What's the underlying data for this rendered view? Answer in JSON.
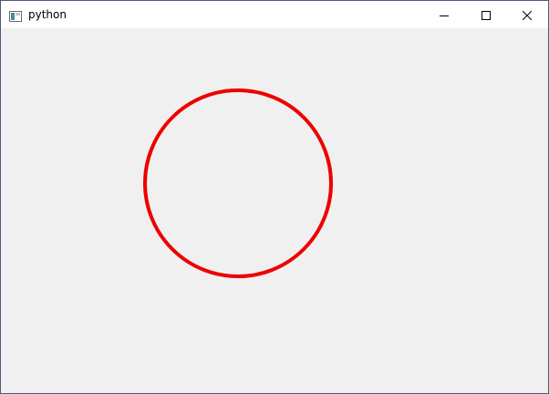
{
  "window": {
    "title": "python",
    "icons": {
      "app": "app-window-icon",
      "minimize": "minimize-icon",
      "maximize": "maximize-icon",
      "close": "close-icon"
    }
  },
  "canvas": {
    "shape": "circle",
    "stroke_color": "#ee0000",
    "background_color": "#f0f0f0"
  }
}
